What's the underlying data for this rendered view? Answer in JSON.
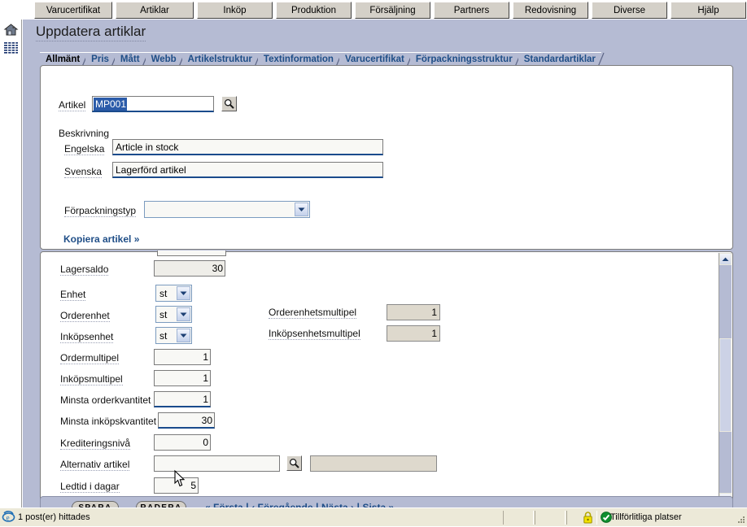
{
  "window": {
    "main_tabs": [
      "Varucertifikat",
      "Artiklar",
      "Inköp",
      "Produktion",
      "Försäljning",
      "Partners",
      "Redovisning",
      "Diverse",
      "Hjälp"
    ],
    "sidebar_icons": [
      "home-icon",
      "list-icon"
    ]
  },
  "page": {
    "title": "Uppdatera artiklar",
    "sub_tabs": [
      {
        "label": "Allmänt",
        "active": true
      },
      {
        "label": "Pris",
        "active": false
      },
      {
        "label": "Mått",
        "active": false
      },
      {
        "label": "Webb",
        "active": false
      },
      {
        "label": "Artikelstruktur",
        "active": false
      },
      {
        "label": "Textinformation",
        "active": false
      },
      {
        "label": "Varucertifikat",
        "active": false
      },
      {
        "label": "Förpackningsstruktur",
        "active": false
      },
      {
        "label": "Standardartiklar",
        "active": false
      }
    ]
  },
  "top_panel": {
    "artikel_label": "Artikel",
    "artikel_value": "MP001",
    "artikel_search_icon": "magnifier-icon",
    "beskrivning_label": "Beskrivning",
    "engelska_label": "Engelska",
    "engelska_value": "Article in stock",
    "svenska_label": "Svenska",
    "svenska_value": "Lagerförd artikel",
    "forpackningstyp_label": "Förpackningstyp",
    "forpackningstyp_value": "",
    "forpackningstyp_options": [
      ""
    ],
    "kopiera_link": "Kopiera artikel »"
  },
  "bottom_panel": {
    "rows": [
      {
        "label": "Lagersaldo",
        "value": "30",
        "kind": "readonly-num"
      },
      {
        "label": "Enhet",
        "value": "st",
        "kind": "select"
      },
      {
        "label": "Orderenhet",
        "value": "st",
        "kind": "select"
      },
      {
        "label": "Inköpsenhet",
        "value": "st",
        "kind": "select"
      },
      {
        "label": "Ordermultipel",
        "value": "1",
        "kind": "num"
      },
      {
        "label": "Inköpsmultipel",
        "value": "1",
        "kind": "num"
      },
      {
        "label": "Minsta orderkvantitet",
        "value": "1",
        "kind": "num-focus"
      },
      {
        "label": "Minsta inköpskvantitet",
        "value": "30",
        "kind": "num-focus"
      },
      {
        "label": "Krediteringsnivå",
        "value": "0",
        "kind": "num"
      },
      {
        "label": "Alternativ artikel",
        "value": "",
        "kind": "lookup"
      },
      {
        "label": "Ledtid i dagar",
        "value": "5",
        "kind": "num"
      }
    ],
    "right_rows": [
      {
        "label": "Orderenhetsmultipel",
        "value": "1"
      },
      {
        "label": "Inköpsenhetsmultipel",
        "value": "1"
      }
    ],
    "unit_options": [
      "st"
    ],
    "lookup_icon": "magnifier-icon",
    "scrollbar": {
      "up_icon": "scroll-up-icon",
      "down_icon": "scroll-down-icon"
    }
  },
  "actions": {
    "save_label": "SPARA",
    "delete_label": "RADERA",
    "nav": {
      "first": "« Första",
      "prev": "‹ Föregående",
      "next": "Nästa ›",
      "last": "Sista »",
      "separator": "|"
    }
  },
  "statusbar": {
    "ie_icon": "internet-explorer-icon",
    "message": "1 post(er) hittades",
    "lock_icon": "lock-icon",
    "zone_icon": "trusted-zone-icon",
    "zone_label": "Tillförlitliga platser",
    "grip_icon": "resize-grip-icon"
  },
  "colors": {
    "app_background": "#b5bbd3",
    "panel_background": "#ffffff",
    "link_blue": "#1f4e87",
    "tab_face": "#d4d0c8",
    "field_focus_border": "#1a4b8c",
    "disabled_field": "#ded9cd",
    "status_bar": "#ece9d8"
  }
}
